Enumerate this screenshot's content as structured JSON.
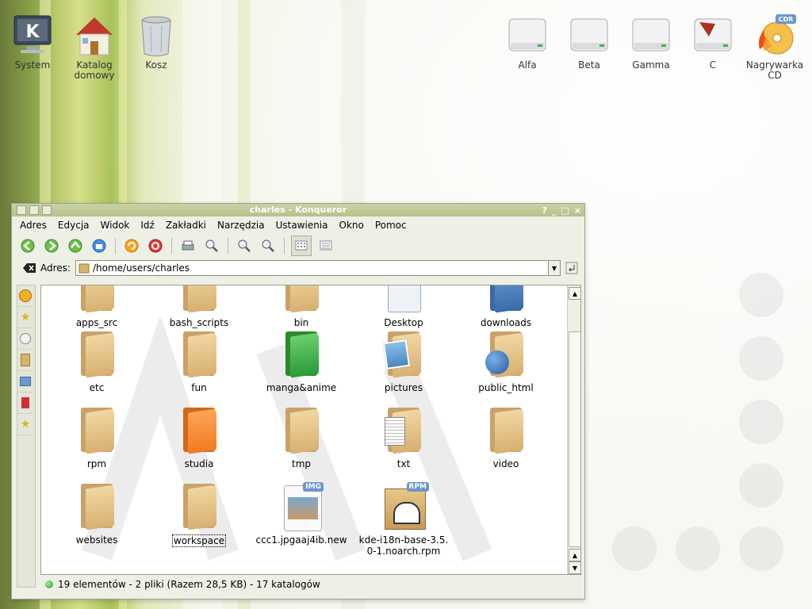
{
  "desktop": {
    "icons_left": [
      {
        "label": "System",
        "icon": "kde-system-icon"
      },
      {
        "label": "Katalog domowy",
        "icon": "home-folder-icon"
      },
      {
        "label": "Kosz",
        "icon": "trash-icon"
      }
    ],
    "icons_right": [
      {
        "label": "Alfa",
        "icon": "drive-icon"
      },
      {
        "label": "Beta",
        "icon": "drive-icon"
      },
      {
        "label": "Gamma",
        "icon": "drive-icon"
      },
      {
        "label": "C",
        "icon": "drive-windows-icon"
      },
      {
        "label": "Nagrywarka CD",
        "icon": "cd-burner-icon",
        "badge": "CDR"
      }
    ]
  },
  "window": {
    "title": "charles - Konqueror",
    "title_buttons": [
      "?",
      "_",
      "□",
      "×"
    ],
    "menu": [
      "Adres",
      "Edycja",
      "Widok",
      "Idź",
      "Zakładki",
      "Narzędzia",
      "Ustawienia",
      "Okno",
      "Pomoc"
    ],
    "toolbar_icons": [
      "back-icon",
      "forward-icon",
      "up-icon",
      "home-icon",
      "reload-icon",
      "stop-icon",
      "print-icon",
      "find-icon",
      "zoom-in-icon",
      "zoom-out-icon",
      "icon-view-icon",
      "list-view-icon"
    ],
    "address": {
      "label": "Adres:",
      "value": "/home/users/charles"
    },
    "sidebar_icons": [
      "history-icon",
      "bookmarks-icon",
      "media-icon",
      "devices-icon",
      "network-icon",
      "services-icon",
      "favorites-icon"
    ],
    "files_row0": [
      "apps_src",
      "bash_scripts",
      "bin",
      "Desktop",
      "downloads"
    ],
    "files": [
      {
        "name": "etc",
        "kind": "folder"
      },
      {
        "name": "fun",
        "kind": "folder"
      },
      {
        "name": "manga&anime",
        "kind": "folder-green"
      },
      {
        "name": "pictures",
        "kind": "folder-pictures"
      },
      {
        "name": "public_html",
        "kind": "folder-globe"
      },
      {
        "name": "rpm",
        "kind": "folder"
      },
      {
        "name": "studia",
        "kind": "folder-orange"
      },
      {
        "name": "tmp",
        "kind": "folder"
      },
      {
        "name": "txt",
        "kind": "folder-text"
      },
      {
        "name": "video",
        "kind": "folder"
      },
      {
        "name": "websites",
        "kind": "folder"
      },
      {
        "name": "workspace",
        "kind": "folder",
        "selected": true
      },
      {
        "name": "ccc1.jpgaaj4ib.new",
        "kind": "image-file",
        "badge": "IMG"
      },
      {
        "name": "kde-i18n-base-3.5.0-1.noarch.rpm",
        "kind": "rpm-file",
        "badge": "RPM",
        "label_line1": "kde-i18n-base-3.5.",
        "label_line2": "0-1.noarch.rpm"
      }
    ],
    "status": "19 elementów - 2 pliki (Razem 28,5 KB) - 17 katalogów"
  }
}
